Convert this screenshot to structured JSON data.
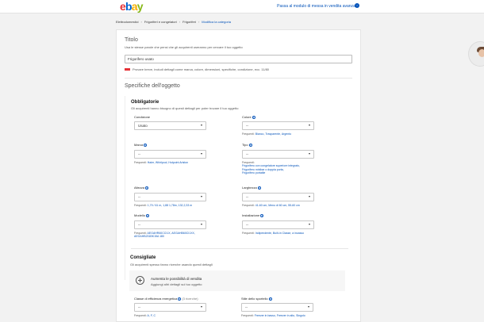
{
  "header": {
    "logo": {
      "l1": "e",
      "l2": "b",
      "l3": "a",
      "l4": "y"
    },
    "switch_link": "Passa al modulo di messa in vendita avanzato",
    "switch_icon": "arrow-right-circle-icon"
  },
  "breadcrumb": {
    "items": [
      "Elettrodomestici",
      "Frigoriferi e congelatori",
      "Frigoriferi"
    ],
    "current": "Modifica la categoria"
  },
  "title_section": {
    "heading": "Titolo",
    "help": "Usa le stesse parole che pensi che gli acquirenti useranno per cercare il tuo oggetto",
    "value": "Frigorifero usato",
    "warning": "Provare breve, includi dettagli come marca, colore, dimensioni, specifiche, condizione, ecc. 11/80"
  },
  "specifics": {
    "heading": "Specifiche dell'oggetto",
    "required": {
      "heading": "Obbligatorie",
      "help": "Gli acquirenti hanno bisogno di questi dettagli per poter trovare il tuo oggetto",
      "frequent_label": "Frequenti:",
      "fields": {
        "condizione": {
          "label": "Condizione",
          "value": "Usato"
        },
        "colore": {
          "label": "Colore",
          "value": "--",
          "frequent": "Bianco, Trasparente, Argento"
        },
        "marca": {
          "label": "Marca",
          "value": "--",
          "frequent": "Haier, Whirlpool, Hotpoint Ariston"
        },
        "tipo": {
          "label": "Tipo",
          "value": "--",
          "frequent": [
            "Frigorifero con congelatore superiore integrato,",
            "Frigorifero minibar o doppia porta,",
            "Frigorifero portatile"
          ]
        },
        "altezza": {
          "label": "Altezza",
          "value": "--",
          "frequent": "1,79 / 61 m, 1,88 1,78m, 132,2,33 m"
        },
        "larghezza": {
          "label": "Larghezza",
          "value": "--",
          "frequent": "41-60 cm, Meno di 60 cm, 55-60 cm"
        },
        "modello": {
          "label": "Modello",
          "value": "--",
          "frequent": [
            "AEGAHR60CCI1X, AEGAHB60CI1XX,",
            "AEGAHB231BK15A 180"
          ]
        },
        "installazione": {
          "label": "Installazione",
          "value": "--",
          "frequent": "Indipendente, Built-in Classe, a incasso"
        }
      }
    },
    "recommended": {
      "heading": "Consigliate",
      "help": "Gli acquirenti spesso fanno ricerche usando questi dettagli",
      "add_title": "Aumenta le possibilità di vendita",
      "add_sub": "Aggiungi altri dettagli sul tuo oggetto",
      "fields": {
        "classe": {
          "label": "Classe di efficienza energetica",
          "note": "(3 ricerche)",
          "value": "--",
          "frequent": "A, F, C"
        },
        "stile": {
          "label": "Stile dello sportello",
          "value": "--",
          "frequent": "Freezer in basso, Freezer in alto, Singolo"
        }
      }
    }
  },
  "colors": {
    "accent": "#0654ba",
    "warning": "#e53238"
  }
}
